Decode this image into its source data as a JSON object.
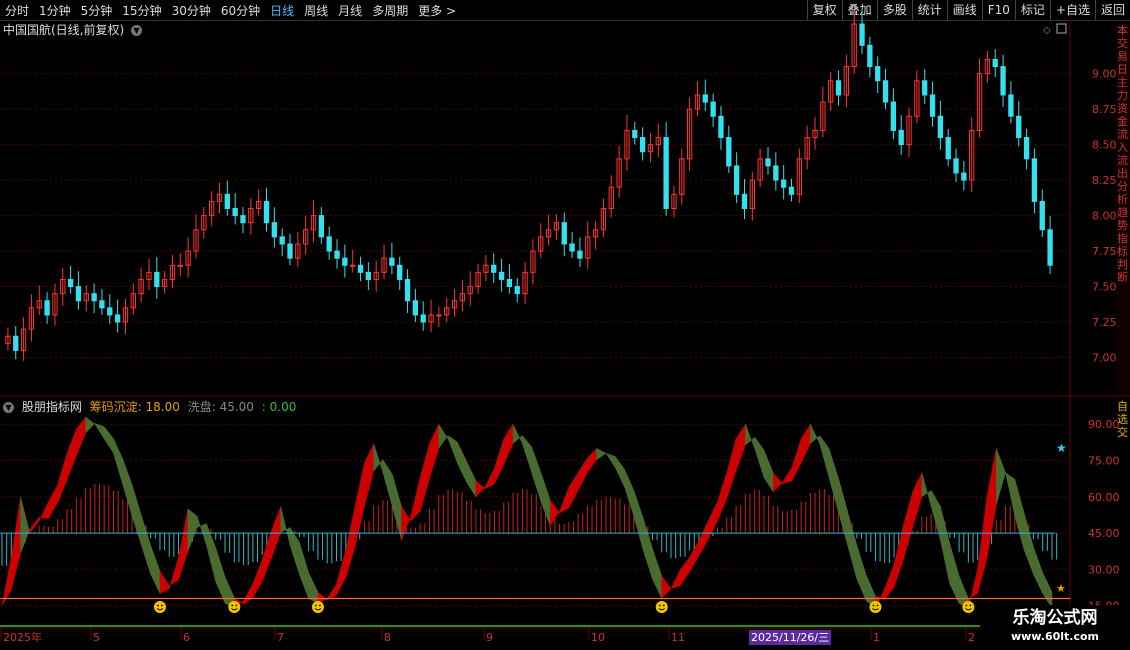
{
  "toolbar": {
    "tabs": [
      "分时",
      "1分钟",
      "5分钟",
      "15分钟",
      "30分钟",
      "60分钟",
      "日线",
      "周线",
      "月线",
      "多周期",
      "更多 >"
    ],
    "active_tab": "日线",
    "right_buttons": [
      "复权",
      "叠加",
      "多股",
      "统计",
      "画线",
      "F10",
      "标记",
      "+自选",
      "返回"
    ]
  },
  "stock_title": "中国国航(日线,前复权)",
  "indicator": {
    "name": "股朋指标网",
    "params": [
      {
        "label": "筹码沉淀: 18.00",
        "color": "#e8a000"
      },
      {
        "label": "洗盘: 45.00",
        "color": "#888888"
      },
      {
        "label": ": 0.00",
        "color": "#30c030"
      }
    ]
  },
  "right_side_text": "本交易日主力资金流入流出分析趋势指标判断",
  "right_side_text2": "自选交",
  "watermark": {
    "line1": "乐淘公式网",
    "line2": "www.60lt.com"
  },
  "date_badge": "2025/11/26/三",
  "colors": {
    "up": "#ff3333",
    "down": "#33e0ee",
    "red_band": "#cc0000",
    "green_band": "#4a6b30",
    "hline": "#ff6a30",
    "grid": "#5a0000"
  },
  "chart_data": [
    {
      "type": "candlestick",
      "title": "中国国航(日线,前复权)",
      "y_ticks": [
        7.0,
        7.25,
        7.5,
        7.75,
        8.0,
        8.25,
        8.5,
        8.75,
        9.0
      ],
      "ylim": [
        6.75,
        9.35
      ],
      "x_labels": [
        "2025年",
        "5",
        "6",
        "7",
        "8",
        "9",
        "10",
        "11",
        "2025/11/26/三",
        "1",
        "2"
      ],
      "close": [
        7.15,
        7.05,
        7.2,
        7.35,
        7.4,
        7.3,
        7.45,
        7.55,
        7.5,
        7.4,
        7.45,
        7.4,
        7.35,
        7.3,
        7.25,
        7.35,
        7.45,
        7.55,
        7.6,
        7.5,
        7.55,
        7.65,
        7.65,
        7.75,
        7.9,
        8.0,
        8.1,
        8.15,
        8.05,
        8.0,
        7.95,
        8.05,
        8.1,
        7.95,
        7.85,
        7.8,
        7.7,
        7.8,
        7.9,
        8.0,
        7.85,
        7.75,
        7.7,
        7.65,
        7.65,
        7.6,
        7.55,
        7.6,
        7.7,
        7.65,
        7.55,
        7.4,
        7.3,
        7.25,
        7.3,
        7.3,
        7.35,
        7.4,
        7.45,
        7.5,
        7.6,
        7.65,
        7.6,
        7.55,
        7.5,
        7.45,
        7.6,
        7.75,
        7.85,
        7.9,
        7.95,
        7.8,
        7.75,
        7.7,
        7.85,
        7.9,
        8.05,
        8.2,
        8.4,
        8.6,
        8.55,
        8.45,
        8.5,
        8.55,
        8.05,
        8.15,
        8.4,
        8.75,
        8.85,
        8.8,
        8.7,
        8.55,
        8.35,
        8.15,
        8.05,
        8.25,
        8.4,
        8.35,
        8.25,
        8.2,
        8.15,
        8.4,
        8.55,
        8.6,
        8.8,
        8.95,
        8.85,
        9.05,
        9.35,
        9.2,
        9.05,
        8.95,
        8.8,
        8.6,
        8.5,
        8.7,
        8.95,
        8.85,
        8.7,
        8.55,
        8.4,
        8.3,
        8.25,
        8.6,
        9.0,
        9.1,
        9.05,
        8.85,
        8.7,
        8.55,
        8.4,
        8.1,
        7.9,
        7.65
      ]
    },
    {
      "type": "area",
      "title": "股朋指标网",
      "y_ticks": [
        15.0,
        30.0,
        45.0,
        60.0,
        75.0,
        90.0
      ],
      "ylim": [
        12,
        100
      ],
      "horizontal_lines": [
        {
          "name": "筹码沉淀",
          "value": 18.0
        },
        {
          "name": "洗盘",
          "value": 45.0
        }
      ],
      "fast": [
        15,
        35,
        60,
        45,
        50,
        58,
        65,
        78,
        88,
        93,
        90,
        84,
        78,
        65,
        52,
        40,
        28,
        20,
        22,
        35,
        55,
        52,
        40,
        25,
        16,
        14,
        17,
        24,
        34,
        46,
        56,
        40,
        28,
        18,
        16,
        18,
        24,
        38,
        56,
        74,
        82,
        70,
        56,
        42,
        52,
        68,
        82,
        90,
        84,
        74,
        66,
        60,
        64,
        72,
        84,
        90,
        82,
        70,
        58,
        48,
        54,
        64,
        70,
        76,
        80,
        78,
        72,
        64,
        52,
        38,
        26,
        18,
        22,
        30,
        35,
        42,
        50,
        58,
        70,
        84,
        90,
        80,
        68,
        62,
        66,
        72,
        84,
        90,
        82,
        68,
        54,
        40,
        26,
        17,
        14,
        22,
        32,
        48,
        62,
        70,
        56,
        42,
        24,
        16,
        14,
        30,
        60,
        80,
        70,
        52,
        38,
        28,
        20,
        14
      ]
    }
  ]
}
